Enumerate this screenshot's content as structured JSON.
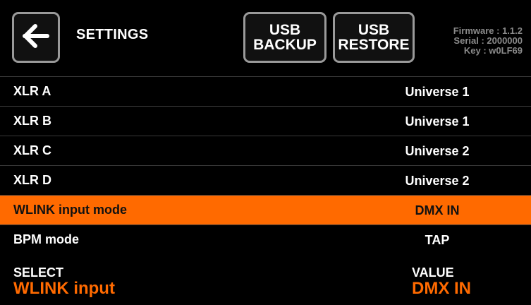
{
  "header": {
    "title": "SETTINGS",
    "back_icon": "arrow-left-icon",
    "usb_backup": {
      "line1": "USB",
      "line2": "BACKUP"
    },
    "usb_restore": {
      "line1": "USB",
      "line2": "RESTORE"
    },
    "firmware": "Firmware : 1.1.2",
    "serial": "Serial : 2000000",
    "key": "Key : w0LF69"
  },
  "settings": [
    {
      "label": "XLR A",
      "value": "Universe 1",
      "selected": false
    },
    {
      "label": "XLR B",
      "value": "Universe 1",
      "selected": false
    },
    {
      "label": "XLR C",
      "value": "Universe 2",
      "selected": false
    },
    {
      "label": "XLR D",
      "value": "Universe 2",
      "selected": false
    },
    {
      "label": "WLINK input mode",
      "value": "DMX IN",
      "selected": true
    },
    {
      "label": "BPM mode",
      "value": "TAP",
      "selected": false
    }
  ],
  "footer": {
    "select_caption": "SELECT",
    "select_value": "WLINK input",
    "value_caption": "VALUE",
    "value_value": "DMX IN"
  },
  "colors": {
    "accent": "#ff6a00",
    "background": "#000000",
    "button_border": "#9a9a9a",
    "muted_text": "#8a8a8a"
  }
}
